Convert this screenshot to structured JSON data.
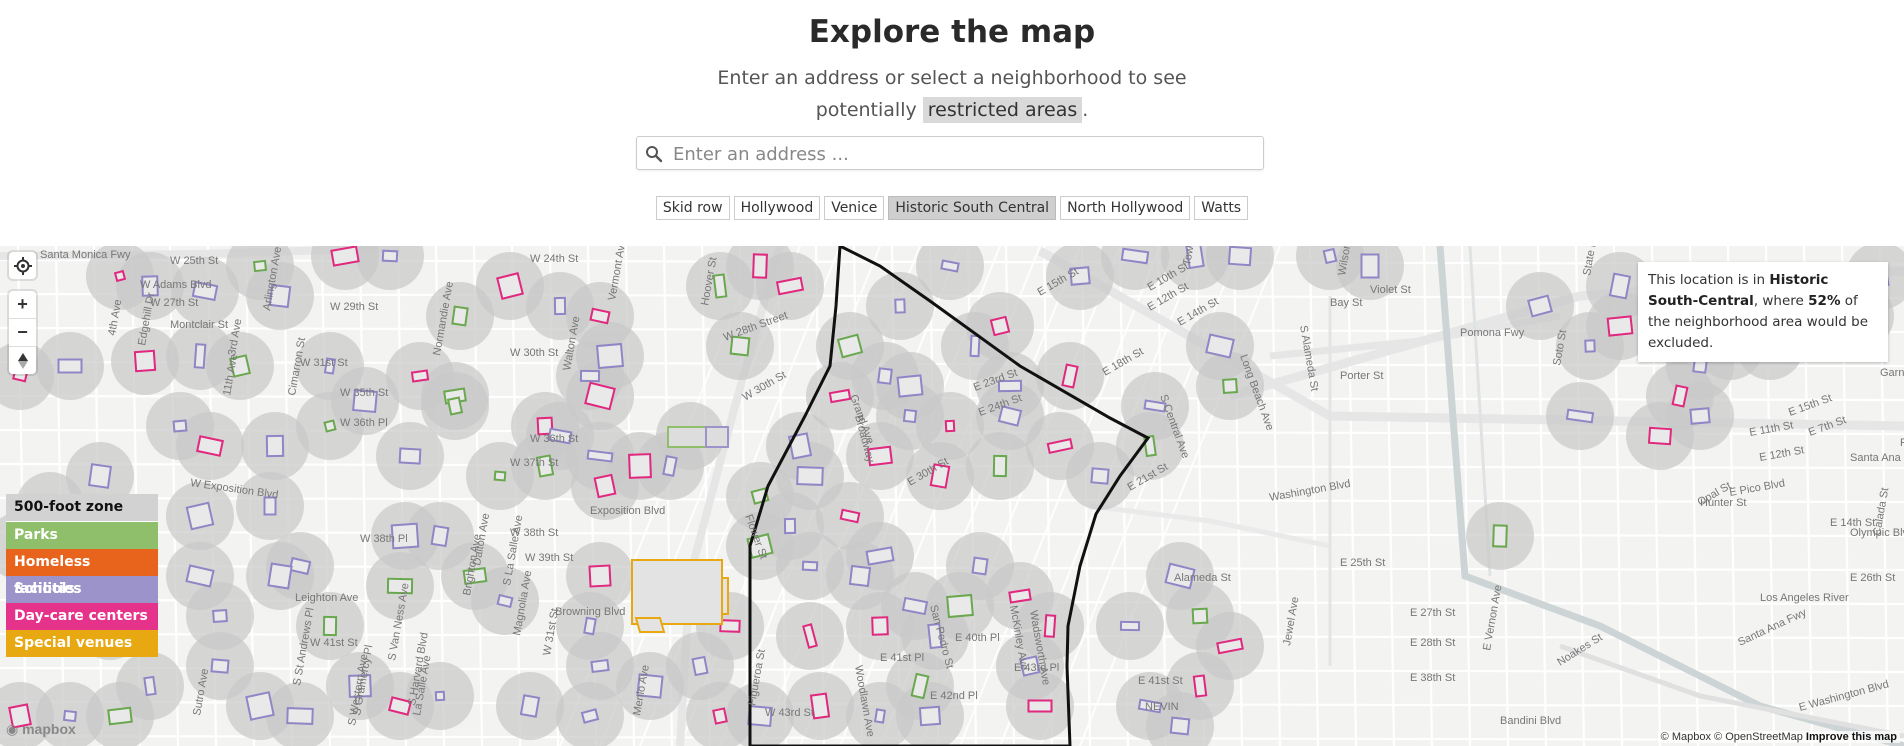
{
  "header": {
    "title": "Explore the map",
    "subtitle_line1": "Enter an address or select a neighborhood to see",
    "subtitle_line2_pre": "potentially",
    "subtitle_highlight": "restricted areas",
    "subtitle_line2_post": "."
  },
  "search": {
    "placeholder": "Enter an address ...",
    "value": ""
  },
  "neighborhoods": [
    "Skid row",
    "Hollywood",
    "Venice",
    "Historic South Central",
    "North Hollywood",
    "Watts"
  ],
  "selected_neighborhood": "Historic South Central",
  "map_controls": {
    "geolocate_icon": "crosshair-icon",
    "zoom_in": "+",
    "zoom_out": "−",
    "compass_icon": "compass-icon"
  },
  "legend": {
    "zone": "500-foot zone",
    "items": [
      {
        "label": "Parks",
        "color": "#8fbf6a"
      },
      {
        "label": "Homeless facilities",
        "color": "#e8641c"
      },
      {
        "label": "Schools",
        "color": "#9b93c9"
      },
      {
        "label": "Day-care centers",
        "color": "#e5328b"
      },
      {
        "label": "Special venues",
        "color": "#e8a812"
      }
    ]
  },
  "info": {
    "prefix": "This location is in",
    "neighborhood": "Historic South-Central",
    "middle": ", where",
    "percent": "52%",
    "suffix": "of the neighborhood area would be excluded."
  },
  "attribution": {
    "mapbox": "© Mapbox",
    "osm": "© OpenStreetMap",
    "improve": "Improve this map",
    "logo": "mapbox"
  },
  "map_labels": [
    "Santa Monica Fwy",
    "W 25th St",
    "W 24th St",
    "W Adams Blvd",
    "W 27th St",
    "Montclair St",
    "W 29th St",
    "W 30th St",
    "W 31st St",
    "W 35th St",
    "W 36th Pl",
    "W 36th St",
    "W 37th St",
    "W Exposition Blvd",
    "Exposition Blvd",
    "W 38th St",
    "W 38th Pl",
    "W 39th St",
    "Leighton Ave",
    "Browning Blvd",
    "W 41st St",
    "W 43rd St",
    "Arlington Ave",
    "Cimarron St",
    "Vermont Ave",
    "Walton Ave",
    "Hoover St",
    "Flower St",
    "Grand Ave",
    "Broadway",
    "Woodlawn Ave",
    "San Pedro St",
    "McKinley Ave",
    "Wadsworth Ave",
    "W 28th Street",
    "W 30th St",
    "E 30th St",
    "E 23rd St",
    "E 24th St",
    "E 21st St",
    "E 15th St",
    "E 12th St",
    "E 14th St",
    "E 18th St",
    "E 10th St",
    "Bay St",
    "Violet St",
    "Porter St",
    "Pomona Fwy",
    "Long Beach Ave",
    "S Alameda St",
    "Washington Blvd",
    "E 25th St",
    "E 27th St",
    "E 28th St",
    "E 38th St",
    "E 41st St",
    "E 40th Pl",
    "E 41st Pl",
    "E 42nd Pl",
    "E 43rd Pl",
    "NEVIN",
    "Alameda St",
    "Jewel Ave",
    "E Vernon Ave",
    "Bandini Blvd",
    "E Washington Blvd",
    "Los Angeles River",
    "Noakes St",
    "E 26th St",
    "Santa Ana Fwy",
    "E 7th St",
    "Olympic Blvd",
    "E 11th St",
    "E 12th St",
    "E Pico Blvd",
    "Hunter St",
    "E 14th St",
    "E 15th St",
    "Opal St",
    "Garnet St",
    "Percy St",
    "Santa Ana St",
    "Soto St",
    "State Fwy",
    "Calada St",
    "Wilson St",
    "Towne Ave",
    "S Central Ave",
    "Figueroa St",
    "Menlo Ave",
    "W 31st St",
    "Magnolia Ave",
    "4th Ave",
    "3rd Ave",
    "11th Ave",
    "Edgehill Dr",
    "Dalton Ave",
    "Brighton Ave",
    "S La Salle Ave",
    "Normandie Ave",
    "S Western Ave",
    "S Harvard Blvd",
    "La Salle Ave",
    "S Gramercy Pl",
    "S St Andrews Pl",
    "S Van Ness Ave",
    "Sutro Ave"
  ]
}
